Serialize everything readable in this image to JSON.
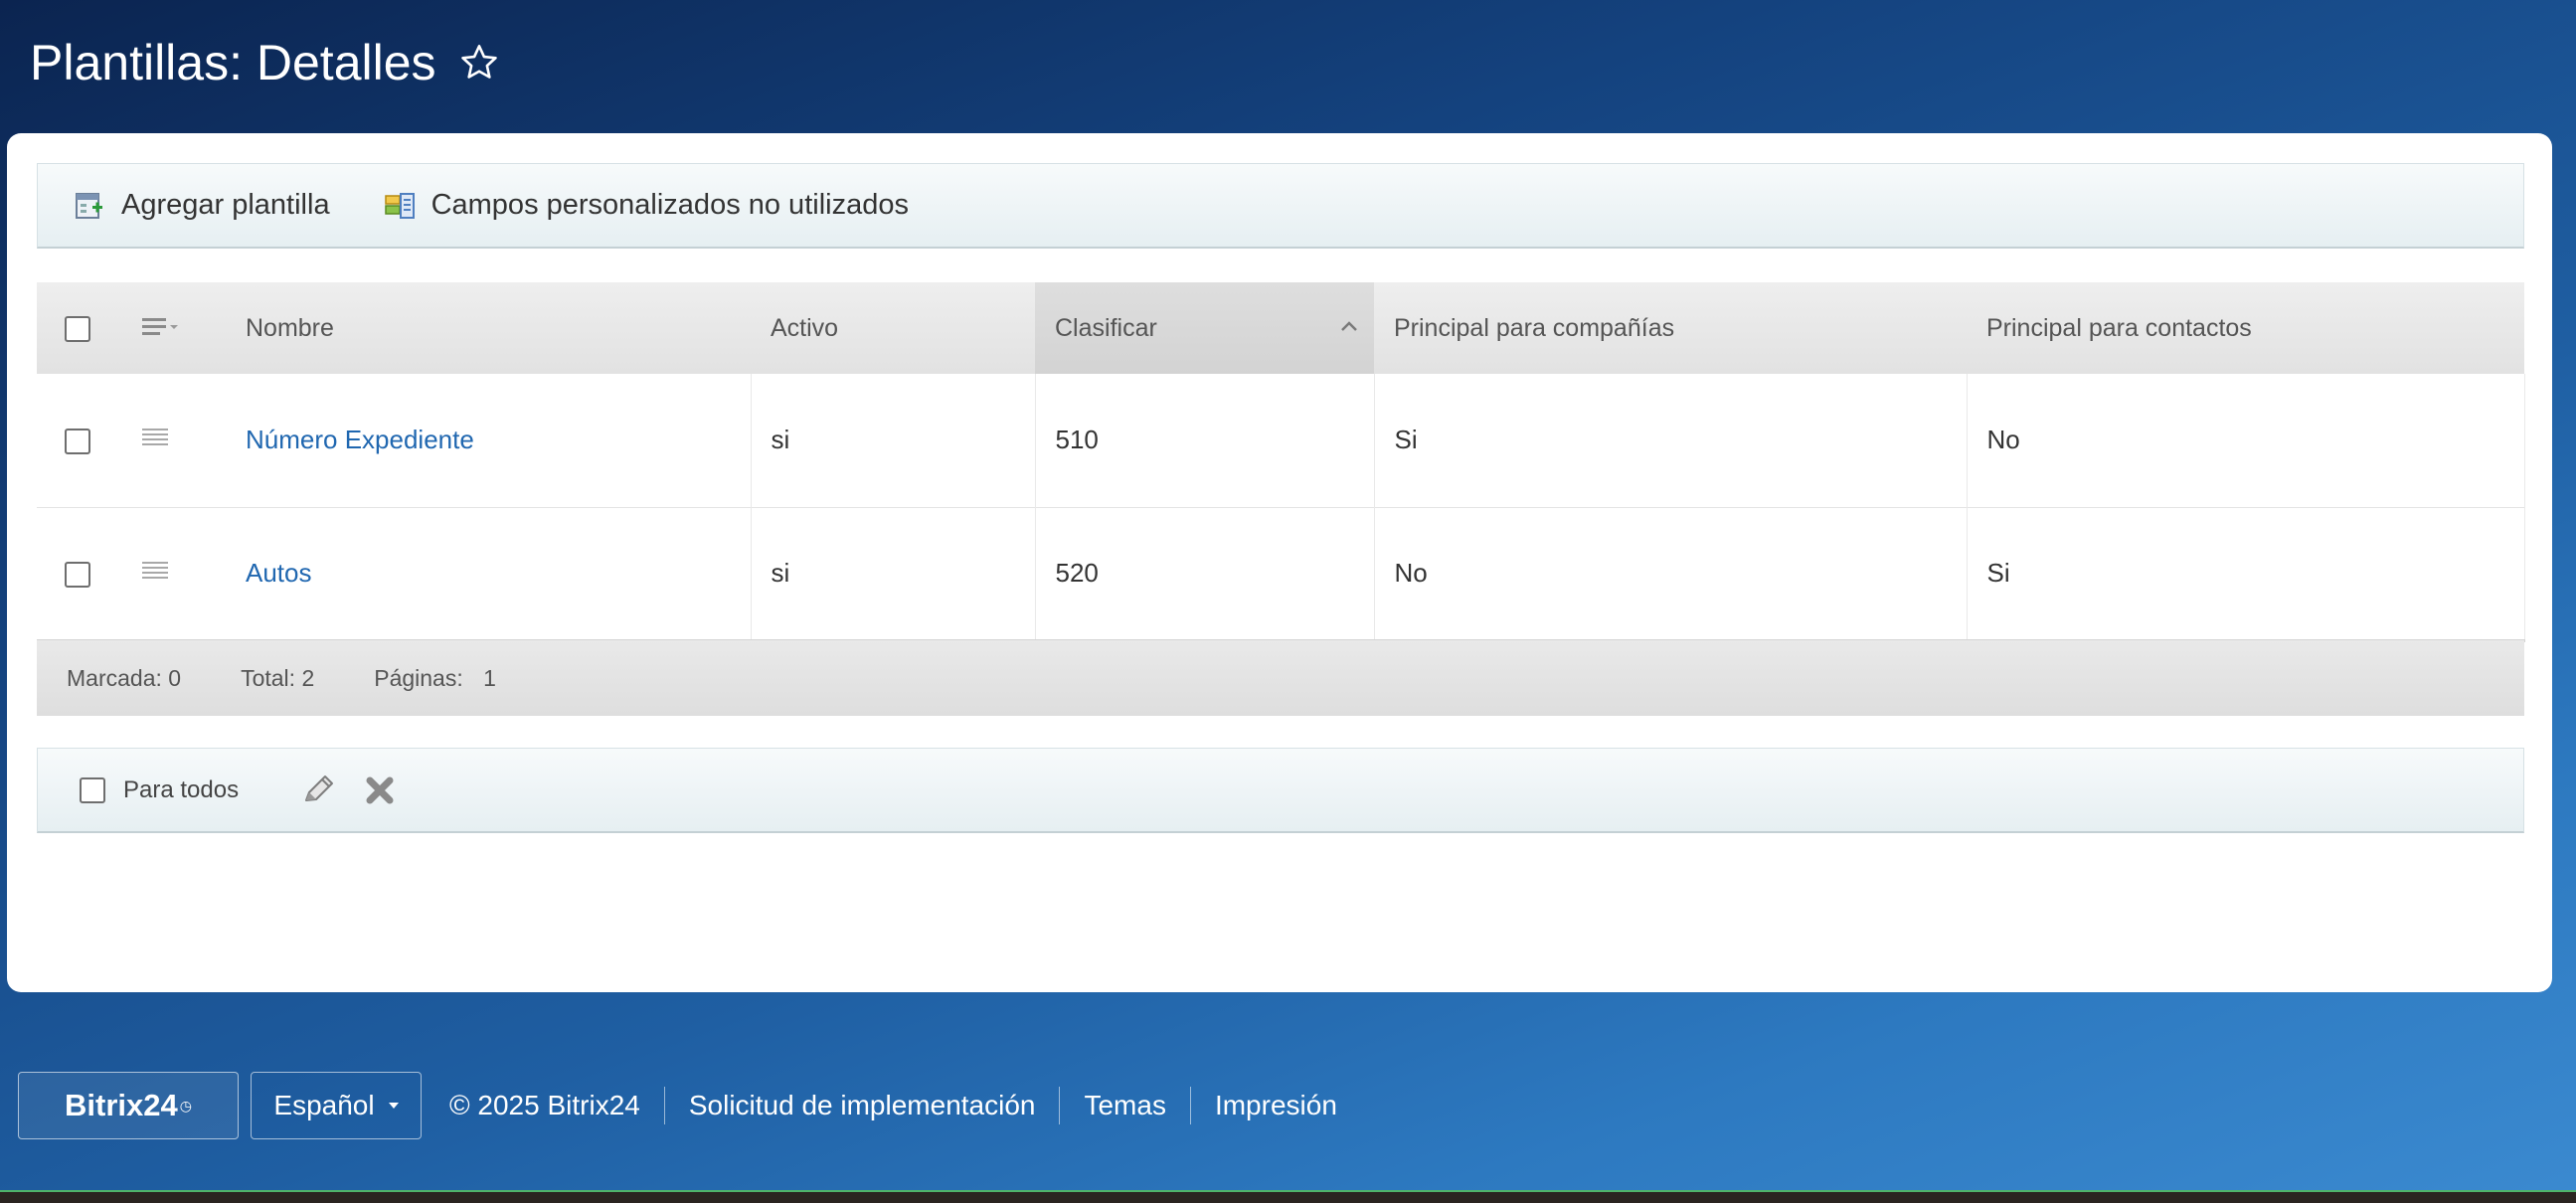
{
  "page": {
    "title": "Plantillas: Detalles"
  },
  "toolbar": {
    "add_label": "Agregar plantilla",
    "unused_fields_label": "Campos personalizados no utilizados"
  },
  "grid": {
    "columns": [
      "Nombre",
      "Activo",
      "Clasificar",
      "Principal para compañías",
      "Principal para contactos"
    ],
    "sorted_column": "Clasificar",
    "rows": [
      {
        "name": "Número Expediente",
        "active": "si",
        "sort": "510",
        "main_companies": "Si",
        "main_contacts": "No"
      },
      {
        "name": "Autos",
        "active": "si",
        "sort": "520",
        "main_companies": "No",
        "main_contacts": "Si"
      }
    ],
    "footer": {
      "marked_label": "Marcada:",
      "marked_value": "0",
      "total_label": "Total:",
      "total_value": "2",
      "pages_label": "Páginas:",
      "pages_value": "1"
    }
  },
  "actions": {
    "for_all_label": "Para todos"
  },
  "site_footer": {
    "brand": "Bitrix24",
    "language": "Español",
    "copyright": "© 2025 Bitrix24",
    "links": [
      "Solicitud de implementación",
      "Temas",
      "Impresión"
    ]
  },
  "colors": {
    "link": "#2067b0",
    "background_top": "#0b2450",
    "background_bottom": "#3b8ad0"
  }
}
